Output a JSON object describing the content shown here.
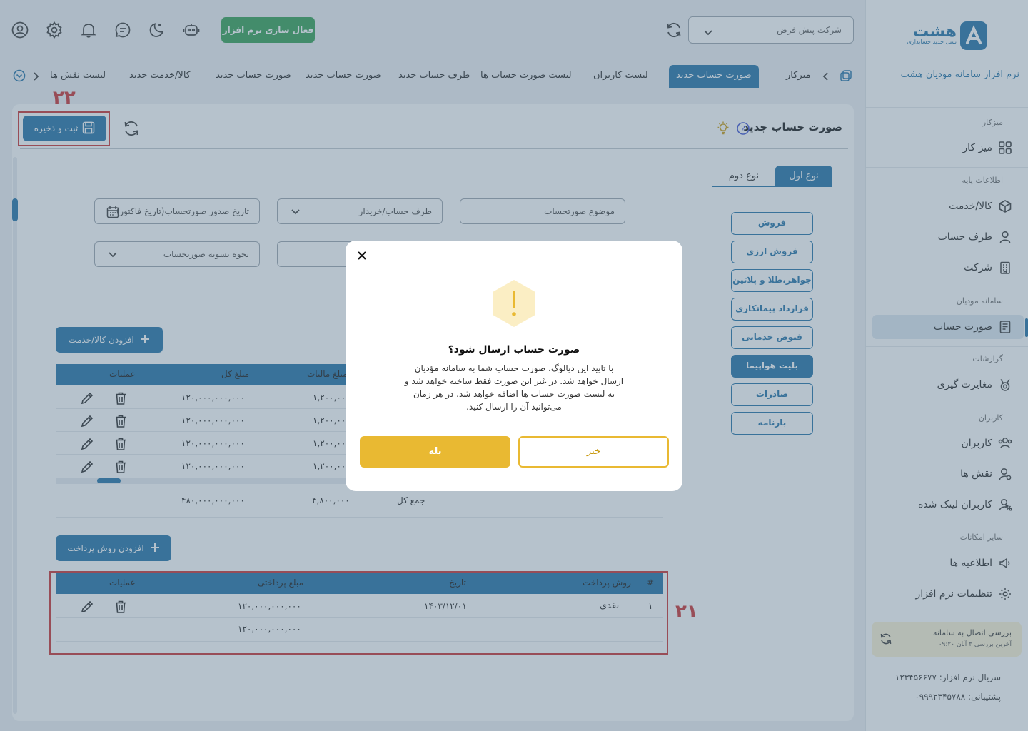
{
  "sidebar": {
    "logo_text": "هشت",
    "logo_sub": "نسل جدید حسابداری",
    "app_title": "نرم افزار سامانه مودیان هشت",
    "sections": [
      {
        "title": "میزکار",
        "items": [
          {
            "label": "میز کار",
            "icon": "grid-icon"
          }
        ]
      },
      {
        "title": "اطلاعات پایه",
        "items": [
          {
            "label": "کالا/خدمت",
            "icon": "box-icon"
          },
          {
            "label": "طرف حساب",
            "icon": "user-icon"
          },
          {
            "label": "شرکت",
            "icon": "building-icon"
          }
        ]
      },
      {
        "title": "سامانه مودیان",
        "items": [
          {
            "label": "صورت حساب",
            "icon": "invoice-icon",
            "active": true
          }
        ]
      },
      {
        "title": "گزارشات",
        "items": [
          {
            "label": "مغایرت گیری",
            "icon": "medal-icon"
          }
        ]
      },
      {
        "title": "کاربران",
        "items": [
          {
            "label": "کاربران",
            "icon": "users-icon"
          },
          {
            "label": "نقش ها",
            "icon": "user-role-icon"
          },
          {
            "label": "کاربران لینک شده",
            "icon": "user-link-icon"
          }
        ]
      },
      {
        "title": "سایر امکانات",
        "items": [
          {
            "label": "اطلاعیه ها",
            "icon": "announcement-icon"
          },
          {
            "label": "تنظیمات نرم افزار",
            "icon": "gear-icon"
          }
        ]
      }
    ],
    "connection": {
      "title": "بررسی اتصال به سامانه",
      "subtitle": "آخرین بررسی ۳ آبان ۰۹:۲۰"
    },
    "serial": "سریال نرم افزار: ۱۲۳۴۵۶۶۷۷",
    "support": "پشتیبانی: ۰۹۹۹۲۳۴۵۷۸۸"
  },
  "header": {
    "company_select": "شرکت پیش فرض",
    "activate_button": "فعال سازی نرم افزار",
    "tabs": [
      "میزکار",
      "صورت حساب جدید",
      "لیست کاربران",
      "لیست صورت حساب ها",
      "طرف حساب جدید",
      "صورت حساب جدید",
      "صورت حساب جدید",
      "کالا/خدمت جدید",
      "لیست نقش ها"
    ],
    "active_tab_index": 1
  },
  "page": {
    "title": "صورت حساب جدید",
    "save_button": "ثبت و ذخیره",
    "annotation_save": "۲۲",
    "annotation_payment": "۲۱",
    "type_tabs": [
      "نوع اول",
      "نوع دوم"
    ],
    "invoice_types": [
      "فروش",
      "فروش ارزی",
      "جواهر،طلا و پلاتین",
      "قرارداد پیمانکاری",
      "قبوض خدماتی",
      "بلیت هواپیما",
      "صادرات",
      "بارنامه"
    ],
    "selected_type_index": 5,
    "fields": {
      "subject": "موضوع صورتحساب",
      "party": "طرف حساب/خریدار",
      "issue_date": "تاریخ صدور صورتحساب(تاریخ فاکتور)",
      "settlement": "نحوه تسویه صورتحساب"
    },
    "add_item_button": "افزودن کالا/خدمت",
    "items_table": {
      "headers": {
        "ops": "عملیات",
        "total": "مبلغ کل",
        "tax": "مبلغ مالیات"
      },
      "rows": [
        {
          "total": "۱۲۰,۰۰۰,۰۰۰,۰۰۰",
          "tax": "۱,۲۰۰,۰۰"
        },
        {
          "total": "۱۲۰,۰۰۰,۰۰۰,۰۰۰",
          "tax": "۱,۲۰۰,۰۰"
        },
        {
          "total": "۱۲۰,۰۰۰,۰۰۰,۰۰۰",
          "tax": "۱,۲۰۰,۰۰"
        },
        {
          "total": "۱۲۰,۰۰۰,۰۰۰,۰۰۰",
          "tax": "۱,۲۰۰,۰۰"
        }
      ],
      "sum_label": "جمع کل",
      "sum_total": "۴۸۰,۰۰۰,۰۰۰,۰۰۰",
      "sum_tax": "۴,۸۰۰,۰۰۰"
    },
    "add_payment_button": "افزودن روش پرداخت",
    "payment_table": {
      "headers": {
        "num": "#",
        "method": "روش پرداخت",
        "date": "تاریخ",
        "amount": "مبلغ پرداختی",
        "ops": "عملیات"
      },
      "rows": [
        {
          "num": "۱",
          "method": "نقدی",
          "date": "۱۴۰۳/۱۲/۰۱",
          "amount": "۱۲۰,۰۰۰,۰۰۰,۰۰۰"
        }
      ],
      "sum_amount": "۱۲۰,۰۰۰,۰۰۰,۰۰۰"
    }
  },
  "dialog": {
    "title": "صورت حساب ارسال شود؟",
    "body": "با تایید این دیالوگ، صورت حساب شما به سامانه مؤدیان ارسال خواهد شد. در غیر این صورت فقط ساخته خواهد شد و به لیست صورت حساب ها اضافه خواهد شد. در هر زمان می‌توانید آن را ارسال کنید.",
    "yes": "بله",
    "no": "خیر",
    "warning_icon": "exclamation-hexagon-icon"
  },
  "colors": {
    "primary": "#1c6ea4",
    "accent": "#e9b932",
    "activate": "#2e9d4f",
    "annotation": "#c92a2a"
  }
}
